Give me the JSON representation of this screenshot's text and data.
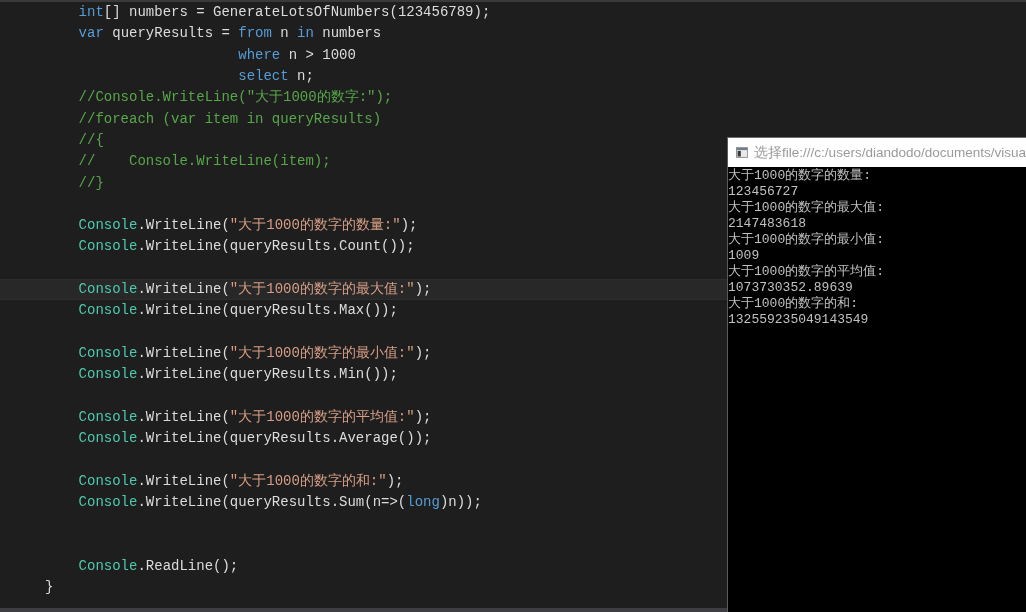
{
  "editor": {
    "lines": [
      {
        "kind": "code",
        "highlighted": false,
        "tokens": [
          {
            "kind": "keyword",
            "text": "    int"
          },
          {
            "kind": "plain",
            "text": "[] numbers = GenerateLotsOfNumbers(123456789);"
          }
        ]
      },
      {
        "kind": "code",
        "highlighted": false,
        "tokens": [
          {
            "kind": "keyword",
            "text": "    var"
          },
          {
            "kind": "plain",
            "text": " queryResults = "
          },
          {
            "kind": "keyword",
            "text": "from"
          },
          {
            "kind": "plain",
            "text": " n "
          },
          {
            "kind": "keyword",
            "text": "in"
          },
          {
            "kind": "plain",
            "text": " numbers"
          }
        ]
      },
      {
        "kind": "code",
        "highlighted": false,
        "tokens": [
          {
            "kind": "keyword",
            "text": "                       where"
          },
          {
            "kind": "plain",
            "text": " n > 1000"
          }
        ]
      },
      {
        "kind": "code",
        "highlighted": false,
        "tokens": [
          {
            "kind": "keyword",
            "text": "                       select"
          },
          {
            "kind": "plain",
            "text": " n;"
          }
        ]
      },
      {
        "kind": "code",
        "highlighted": false,
        "tokens": [
          {
            "kind": "comment",
            "text": "    //Console.WriteLine(\"大于1000的数字:\");"
          }
        ]
      },
      {
        "kind": "code",
        "highlighted": false,
        "tokens": [
          {
            "kind": "comment",
            "text": "    //foreach (var item in queryResults)"
          }
        ]
      },
      {
        "kind": "code",
        "highlighted": false,
        "tokens": [
          {
            "kind": "comment",
            "text": "    //{"
          }
        ]
      },
      {
        "kind": "code",
        "highlighted": false,
        "tokens": [
          {
            "kind": "comment",
            "text": "    //    Console.WriteLine(item);"
          }
        ]
      },
      {
        "kind": "code",
        "highlighted": false,
        "tokens": [
          {
            "kind": "comment",
            "text": "    //}"
          }
        ]
      },
      {
        "kind": "blank",
        "highlighted": false
      },
      {
        "kind": "code",
        "highlighted": false,
        "tokens": [
          {
            "kind": "type",
            "text": "    Console"
          },
          {
            "kind": "plain",
            "text": ".WriteLine("
          },
          {
            "kind": "string",
            "text": "\"大于1000的数字的数量:\""
          },
          {
            "kind": "plain",
            "text": ");"
          }
        ]
      },
      {
        "kind": "code",
        "highlighted": false,
        "tokens": [
          {
            "kind": "type",
            "text": "    Console"
          },
          {
            "kind": "plain",
            "text": ".WriteLine(queryResults.Count());"
          }
        ]
      },
      {
        "kind": "blank",
        "highlighted": false
      },
      {
        "kind": "code",
        "highlighted": true,
        "tokens": [
          {
            "kind": "type",
            "text": "    Console"
          },
          {
            "kind": "plain",
            "text": ".WriteLine("
          },
          {
            "kind": "string",
            "text": "\"大于1000的数字的最大值:\""
          },
          {
            "kind": "plain",
            "text": ");"
          }
        ]
      },
      {
        "kind": "code",
        "highlighted": false,
        "tokens": [
          {
            "kind": "type",
            "text": "    Console"
          },
          {
            "kind": "plain",
            "text": ".WriteLine(queryResults.Max());"
          }
        ]
      },
      {
        "kind": "blank",
        "highlighted": false
      },
      {
        "kind": "code",
        "highlighted": false,
        "tokens": [
          {
            "kind": "type",
            "text": "    Console"
          },
          {
            "kind": "plain",
            "text": ".WriteLine("
          },
          {
            "kind": "string",
            "text": "\"大于1000的数字的最小值:\""
          },
          {
            "kind": "plain",
            "text": ");"
          }
        ]
      },
      {
        "kind": "code",
        "highlighted": false,
        "tokens": [
          {
            "kind": "type",
            "text": "    Console"
          },
          {
            "kind": "plain",
            "text": ".WriteLine(queryResults.Min());"
          }
        ]
      },
      {
        "kind": "blank",
        "highlighted": false
      },
      {
        "kind": "code",
        "highlighted": false,
        "tokens": [
          {
            "kind": "type",
            "text": "    Console"
          },
          {
            "kind": "plain",
            "text": ".WriteLine("
          },
          {
            "kind": "string",
            "text": "\"大于1000的数字的平均值:\""
          },
          {
            "kind": "plain",
            "text": ");"
          }
        ]
      },
      {
        "kind": "code",
        "highlighted": false,
        "tokens": [
          {
            "kind": "type",
            "text": "    Console"
          },
          {
            "kind": "plain",
            "text": ".WriteLine(queryResults.Average());"
          }
        ]
      },
      {
        "kind": "blank",
        "highlighted": false
      },
      {
        "kind": "code",
        "highlighted": false,
        "tokens": [
          {
            "kind": "type",
            "text": "    Console"
          },
          {
            "kind": "plain",
            "text": ".WriteLine("
          },
          {
            "kind": "string",
            "text": "\"大于1000的数字的和:\""
          },
          {
            "kind": "plain",
            "text": ");"
          }
        ]
      },
      {
        "kind": "code",
        "highlighted": false,
        "tokens": [
          {
            "kind": "type",
            "text": "    Console"
          },
          {
            "kind": "plain",
            "text": ".WriteLine(queryResults.Sum(n=>("
          },
          {
            "kind": "keyword",
            "text": "long"
          },
          {
            "kind": "plain",
            "text": ")n));"
          }
        ]
      },
      {
        "kind": "blank",
        "highlighted": false
      },
      {
        "kind": "blank",
        "highlighted": false
      },
      {
        "kind": "code",
        "highlighted": false,
        "tokens": [
          {
            "kind": "type",
            "text": "    Console"
          },
          {
            "kind": "plain",
            "text": ".ReadLine();"
          }
        ]
      },
      {
        "kind": "code",
        "highlighted": false,
        "tokens": [
          {
            "kind": "plain",
            "text": "}"
          }
        ]
      }
    ]
  },
  "console_window": {
    "title": "选择file:///c:/users/diandodo/documents/visua",
    "output": [
      "大于1000的数字的数量:",
      "123456727",
      "大于1000的数字的最大值:",
      "2147483618",
      "大于1000的数字的最小值:",
      "1009",
      "大于1000的数字的平均值:",
      "1073730352.89639",
      "大于1000的数字的和:",
      "132559235049143549"
    ]
  }
}
